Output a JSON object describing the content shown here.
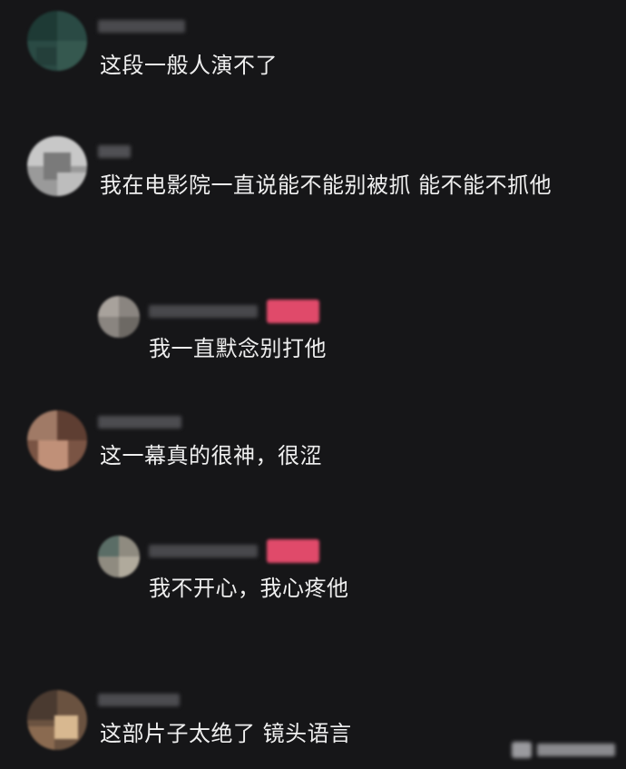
{
  "comments": [
    {
      "text": "这段一般人演不了"
    },
    {
      "text": "我在电影院一直说能不能别被抓 能不能不抓他"
    },
    {
      "text": "我一直默念别打他"
    },
    {
      "text": "这一幕真的很神，很涩"
    },
    {
      "text": "我不开心，我心疼他"
    },
    {
      "text": "这部片子太绝了 镜头语言"
    }
  ],
  "colors": {
    "background": "#161618",
    "text": "#efefef",
    "badge": "#e04a6a"
  }
}
